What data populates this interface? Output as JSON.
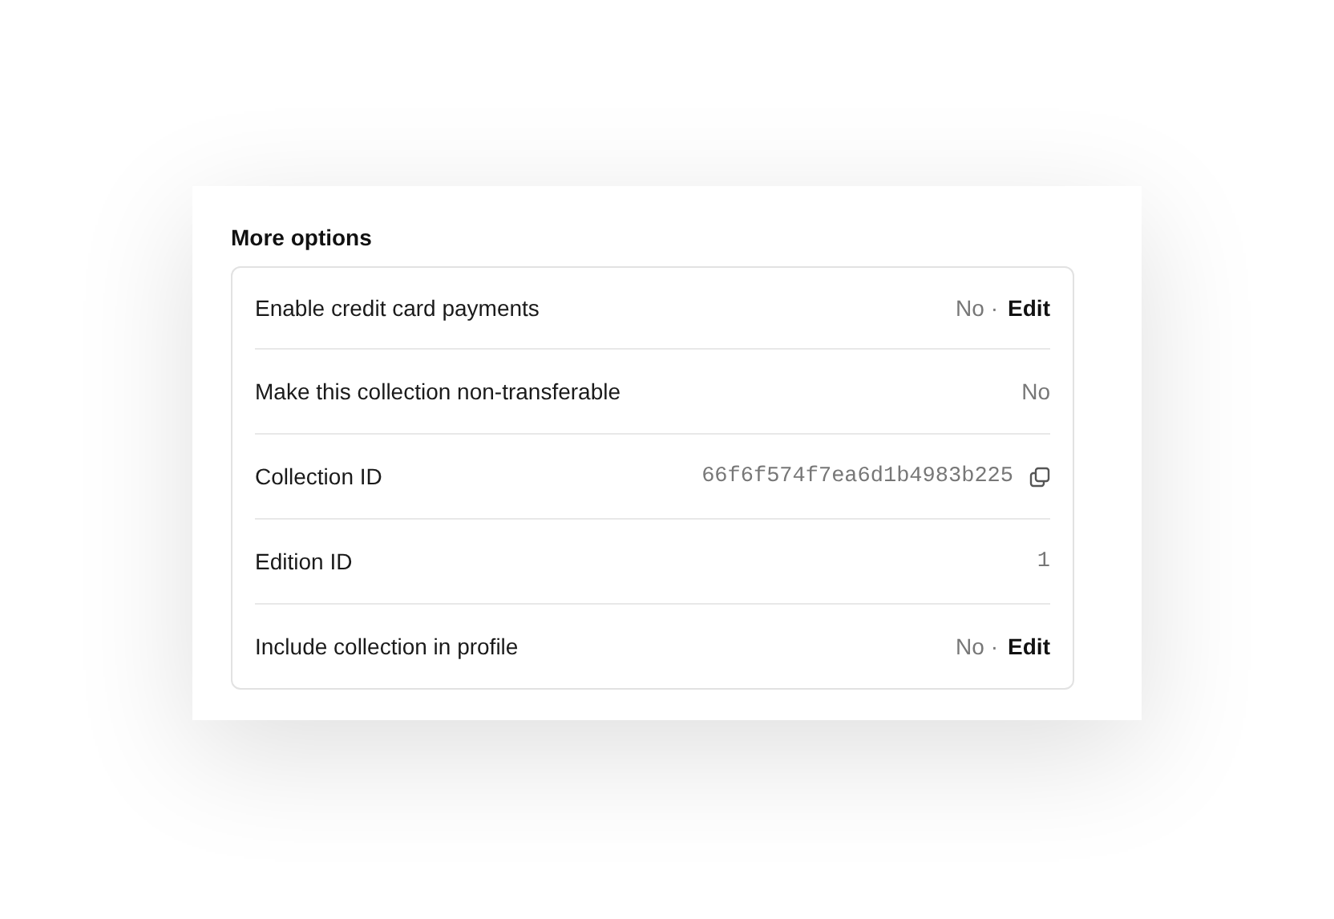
{
  "title": "More options",
  "rows": [
    {
      "kind": "edit",
      "label": "Enable credit card payments",
      "value": "No",
      "separator": "·",
      "action": "Edit"
    },
    {
      "kind": "text",
      "label": "Make this collection non-transferable",
      "value": "No"
    },
    {
      "kind": "copy",
      "label": "Collection ID",
      "value": "66f6f574f7ea6d1b4983b225"
    },
    {
      "kind": "code",
      "label": "Edition ID",
      "value": "1"
    },
    {
      "kind": "edit",
      "label": "Include collection in profile",
      "value": "No",
      "separator": "·",
      "action": "Edit"
    }
  ]
}
